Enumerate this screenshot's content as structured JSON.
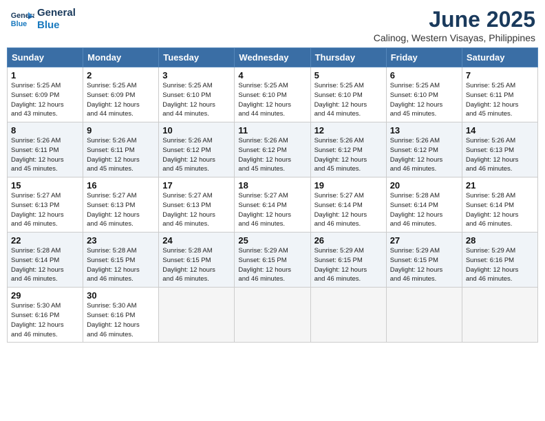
{
  "logo": {
    "line1": "General",
    "line2": "Blue"
  },
  "title": "June 2025",
  "subtitle": "Calinog, Western Visayas, Philippines",
  "headers": [
    "Sunday",
    "Monday",
    "Tuesday",
    "Wednesday",
    "Thursday",
    "Friday",
    "Saturday"
  ],
  "weeks": [
    [
      {
        "day": "1",
        "rise": "5:25 AM",
        "set": "6:09 PM",
        "daylight": "12 hours and 43 minutes."
      },
      {
        "day": "2",
        "rise": "5:25 AM",
        "set": "6:09 PM",
        "daylight": "12 hours and 44 minutes."
      },
      {
        "day": "3",
        "rise": "5:25 AM",
        "set": "6:10 PM",
        "daylight": "12 hours and 44 minutes."
      },
      {
        "day": "4",
        "rise": "5:25 AM",
        "set": "6:10 PM",
        "daylight": "12 hours and 44 minutes."
      },
      {
        "day": "5",
        "rise": "5:25 AM",
        "set": "6:10 PM",
        "daylight": "12 hours and 44 minutes."
      },
      {
        "day": "6",
        "rise": "5:25 AM",
        "set": "6:10 PM",
        "daylight": "12 hours and 45 minutes."
      },
      {
        "day": "7",
        "rise": "5:25 AM",
        "set": "6:11 PM",
        "daylight": "12 hours and 45 minutes."
      }
    ],
    [
      {
        "day": "8",
        "rise": "5:26 AM",
        "set": "6:11 PM",
        "daylight": "12 hours and 45 minutes."
      },
      {
        "day": "9",
        "rise": "5:26 AM",
        "set": "6:11 PM",
        "daylight": "12 hours and 45 minutes."
      },
      {
        "day": "10",
        "rise": "5:26 AM",
        "set": "6:12 PM",
        "daylight": "12 hours and 45 minutes."
      },
      {
        "day": "11",
        "rise": "5:26 AM",
        "set": "6:12 PM",
        "daylight": "12 hours and 45 minutes."
      },
      {
        "day": "12",
        "rise": "5:26 AM",
        "set": "6:12 PM",
        "daylight": "12 hours and 45 minutes."
      },
      {
        "day": "13",
        "rise": "5:26 AM",
        "set": "6:12 PM",
        "daylight": "12 hours and 46 minutes."
      },
      {
        "day": "14",
        "rise": "5:26 AM",
        "set": "6:13 PM",
        "daylight": "12 hours and 46 minutes."
      }
    ],
    [
      {
        "day": "15",
        "rise": "5:27 AM",
        "set": "6:13 PM",
        "daylight": "12 hours and 46 minutes."
      },
      {
        "day": "16",
        "rise": "5:27 AM",
        "set": "6:13 PM",
        "daylight": "12 hours and 46 minutes."
      },
      {
        "day": "17",
        "rise": "5:27 AM",
        "set": "6:13 PM",
        "daylight": "12 hours and 46 minutes."
      },
      {
        "day": "18",
        "rise": "5:27 AM",
        "set": "6:14 PM",
        "daylight": "12 hours and 46 minutes."
      },
      {
        "day": "19",
        "rise": "5:27 AM",
        "set": "6:14 PM",
        "daylight": "12 hours and 46 minutes."
      },
      {
        "day": "20",
        "rise": "5:28 AM",
        "set": "6:14 PM",
        "daylight": "12 hours and 46 minutes."
      },
      {
        "day": "21",
        "rise": "5:28 AM",
        "set": "6:14 PM",
        "daylight": "12 hours and 46 minutes."
      }
    ],
    [
      {
        "day": "22",
        "rise": "5:28 AM",
        "set": "6:14 PM",
        "daylight": "12 hours and 46 minutes."
      },
      {
        "day": "23",
        "rise": "5:28 AM",
        "set": "6:15 PM",
        "daylight": "12 hours and 46 minutes."
      },
      {
        "day": "24",
        "rise": "5:28 AM",
        "set": "6:15 PM",
        "daylight": "12 hours and 46 minutes."
      },
      {
        "day": "25",
        "rise": "5:29 AM",
        "set": "6:15 PM",
        "daylight": "12 hours and 46 minutes."
      },
      {
        "day": "26",
        "rise": "5:29 AM",
        "set": "6:15 PM",
        "daylight": "12 hours and 46 minutes."
      },
      {
        "day": "27",
        "rise": "5:29 AM",
        "set": "6:15 PM",
        "daylight": "12 hours and 46 minutes."
      },
      {
        "day": "28",
        "rise": "5:29 AM",
        "set": "6:16 PM",
        "daylight": "12 hours and 46 minutes."
      }
    ],
    [
      {
        "day": "29",
        "rise": "5:30 AM",
        "set": "6:16 PM",
        "daylight": "12 hours and 46 minutes."
      },
      {
        "day": "30",
        "rise": "5:30 AM",
        "set": "6:16 PM",
        "daylight": "12 hours and 46 minutes."
      },
      null,
      null,
      null,
      null,
      null
    ]
  ],
  "labels": {
    "sunrise": "Sunrise:",
    "sunset": "Sunset:",
    "daylight": "Daylight:"
  }
}
